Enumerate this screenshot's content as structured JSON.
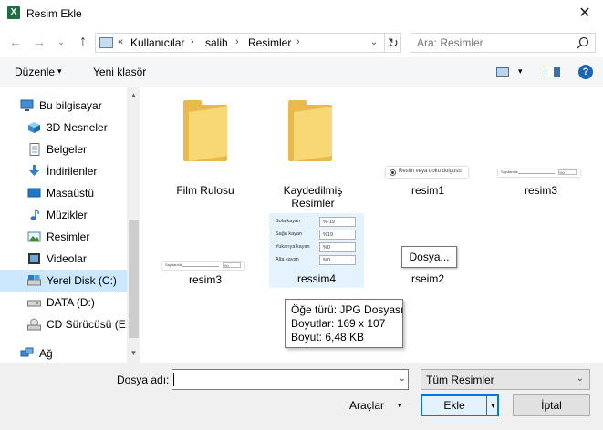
{
  "window": {
    "title": "Resim Ekle",
    "app_icon": "X",
    "close_glyph": "✕"
  },
  "address": {
    "overflow": "«",
    "crumbs": [
      "Kullanıcılar",
      "salih",
      "Resimler"
    ],
    "separator": "›",
    "dropdown_glyph": "⌄",
    "refresh_glyph": "↻"
  },
  "search": {
    "placeholder": "Ara: Resimler"
  },
  "nav_buttons": {
    "back": "←",
    "forward": "→",
    "recent": "⌄",
    "up": "↑"
  },
  "toolbar": {
    "organize": "Düzenle",
    "new_folder": "Yeni klasör",
    "caret": "▾",
    "help": "?"
  },
  "navpane": {
    "items": [
      {
        "label": "Bu bilgisayar",
        "icon": "computer-icon"
      },
      {
        "label": "3D Nesneler",
        "icon": "3d-objects-icon"
      },
      {
        "label": "Belgeler",
        "icon": "documents-icon"
      },
      {
        "label": "İndirilenler",
        "icon": "downloads-icon"
      },
      {
        "label": "Masaüstü",
        "icon": "desktop-icon"
      },
      {
        "label": "Müzikler",
        "icon": "music-icon"
      },
      {
        "label": "Resimler",
        "icon": "pictures-icon"
      },
      {
        "label": "Videolar",
        "icon": "videos-icon"
      },
      {
        "label": "Yerel Disk (C:)",
        "icon": "local-disk-icon"
      },
      {
        "label": "DATA (D:)",
        "icon": "drive-icon"
      },
      {
        "label": "CD Sürücüsü (E:)",
        "icon": "cd-drive-icon"
      },
      {
        "label": "Ağ",
        "icon": "network-icon"
      }
    ],
    "selected_index": 8,
    "scroll_up": "▲",
    "scroll_down": "▼"
  },
  "files": [
    {
      "name": "Film Rulosu",
      "type": "folder"
    },
    {
      "name": "Kaydedilmiş Resimler",
      "type": "folder"
    },
    {
      "name": "resim1",
      "type": "image"
    },
    {
      "name": "resim3",
      "type": "image"
    },
    {
      "name": "resim3",
      "type": "image"
    },
    {
      "name": "ressim4",
      "type": "image"
    },
    {
      "name": "rseim2",
      "type": "image"
    }
  ],
  "thumbs": {
    "resim1_text": "Resim veya doku dolgusu",
    "resim4_rows": [
      {
        "label": "Sola kayan",
        "value": "%-19"
      },
      {
        "label": "Sağa kayan",
        "value": "%19"
      },
      {
        "label": "Yukarıya kayan",
        "value": "%0"
      },
      {
        "label": "Alta kayan",
        "value": "%0"
      }
    ],
    "slider_label": "Saydamlık",
    "slider_value": "%0"
  },
  "popup": {
    "label": "Dosya..."
  },
  "tooltip": {
    "lines": [
      "Öğe türü: JPG Dosyası",
      "Boyutlar: 169 x 107",
      "Boyut: 6,48 KB"
    ]
  },
  "bottom": {
    "filename_label": "Dosya adı:",
    "filename_value": "",
    "filetype": "Tüm Resimler",
    "tools": "Araçlar",
    "insert": "Ekle",
    "cancel": "İptal",
    "dropdown_glyph": "⌄",
    "caret": "▾"
  }
}
